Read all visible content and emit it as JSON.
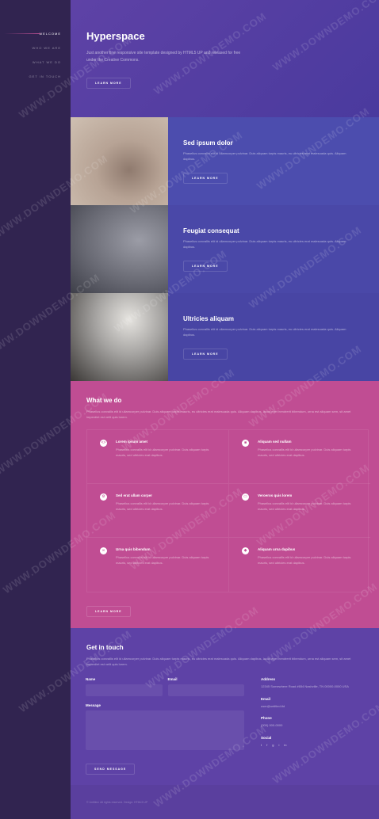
{
  "sidebar": {
    "items": [
      {
        "label": "Welcome",
        "active": true
      },
      {
        "label": "Who we are",
        "active": false
      },
      {
        "label": "What we do",
        "active": false
      },
      {
        "label": "Get in touch",
        "active": false
      }
    ]
  },
  "intro": {
    "title": "Hyperspace",
    "text": "Just another fine responsive site template designed by HTML5 UP and released for free under the Creative Commons.",
    "button": "Learn more"
  },
  "spotlights": [
    {
      "title": "Sed ipsum dolor",
      "text": "Phasellus convallis elit id ullamcorper pulvinar. Duis aliquam turpis mauris, eu ultricies erat malesuada quis. Aliquam dapibus.",
      "button": "Learn more"
    },
    {
      "title": "Feugiat consequat",
      "text": "Phasellus convallis elit id ullamcorper pulvinar. Duis aliquam turpis mauris, eu ultricies erat malesuada quis. Aliquam dapibus.",
      "button": "Learn more"
    },
    {
      "title": "Ultricies aliquam",
      "text": "Phasellus convallis elit id ullamcorper pulvinar. Duis aliquam turpis mauris, eu ultricies erat malesuada quis. Aliquam dapibus.",
      "button": "Learn more"
    }
  ],
  "what_we_do": {
    "title": "What we do",
    "text": "Phasellus convallis elit id ullamcorper pulvinar. Duis aliquam turpis mauris, eu ultricies erat malesuada quis. Aliquam dapibus, lacus eget hendrerit bibendum, urna est aliquam sem, sit amet imperdiet est velit quis lorem.",
    "features": [
      {
        "icon": "code-icon",
        "glyph": "<>",
        "title": "Lorem ipsum amet",
        "text": "Phasellus convallis elit id ullamcorper pulvinar. Duis aliquam turpis mauris, sed ultricies erat dapibus."
      },
      {
        "icon": "lock-icon",
        "glyph": "■",
        "title": "Aliquam sed nullam",
        "text": "Phasellus convallis elit id ullamcorper pulvinar. Duis aliquam turpis mauris, sed ultricies erat dapibus."
      },
      {
        "icon": "cog-icon",
        "glyph": "⚙",
        "title": "Sed erat ullam corper",
        "text": "Phasellus convallis elit id ullamcorper pulvinar. Duis aliquam turpis mauris, sed ultricies erat dapibus."
      },
      {
        "icon": "desktop-icon",
        "glyph": "▭",
        "title": "Veroeros quis lorem",
        "text": "Phasellus convallis elit id ullamcorper pulvinar. Duis aliquam turpis mauris, sed ultricies erat dapibus."
      },
      {
        "icon": "link-icon",
        "glyph": "∞",
        "title": "Urna quis bibendum",
        "text": "Phasellus convallis elit id ullamcorper pulvinar. Duis aliquam turpis mauris, sed ultricies erat dapibus."
      },
      {
        "icon": "gem-icon",
        "glyph": "◆",
        "title": "Aliquam urna dapibus",
        "text": "Phasellus convallis elit id ullamcorper pulvinar. Duis aliquam turpis mauris, sed ultricies erat dapibus."
      }
    ],
    "button": "Learn more"
  },
  "contact": {
    "title": "Get in touch",
    "text": "Phasellus convallis elit id ullamcorper pulvinar. Duis aliquam turpis mauris, eu ultricies erat malesuada quis. Aliquam dapibus, lacus eget hendrerit bibendum, urna est aliquam sem, sit amet imperdiet est velit quis lorem.",
    "name_label": "Name",
    "email_label": "Email",
    "message_label": "Message",
    "send_button": "Send Message",
    "address_label": "Address",
    "address": "12345 Somewhere Road #654 Nashville, TN 00000-0000 USA",
    "email_info_label": "Email",
    "email": "user@untitled.tld",
    "phone_label": "Phone",
    "phone": "(000) 000-0000",
    "social_label": "Social",
    "social_icons": [
      "twitter-icon",
      "facebook-icon",
      "github-icon",
      "instagram-icon",
      "linkedin-icon"
    ],
    "social_glyphs": [
      "t",
      "f",
      "g",
      "i",
      "in"
    ]
  },
  "footer": {
    "text": "© Untitled. All rights reserved. Design: HTML5 UP"
  },
  "watermark": "WWW.DOWNDEMO.COM"
}
